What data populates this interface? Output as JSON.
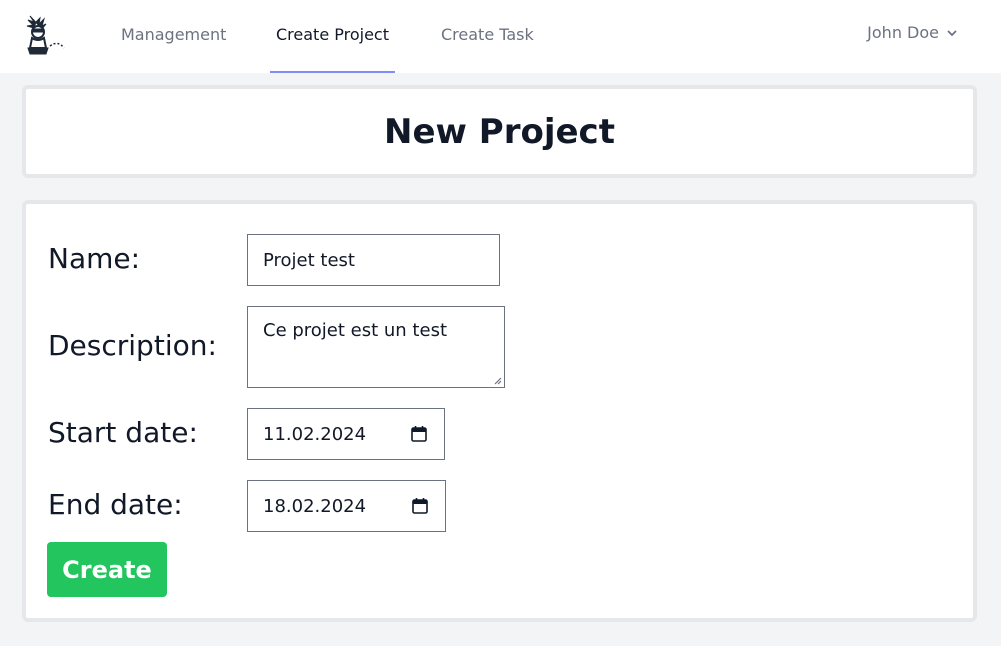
{
  "nav": {
    "links": [
      "Management",
      "Create Project",
      "Create Task"
    ],
    "active": "Create Project",
    "user_name": "John Doe"
  },
  "page": {
    "title": "New Project"
  },
  "form": {
    "name_label": "Name:",
    "name_value": "Projet test",
    "description_label": "Description:",
    "description_value": "Ce projet est un test",
    "start_label": "Start date:",
    "start_value": "11.02.2024",
    "end_label": "End date:",
    "end_value": "18.02.2024",
    "submit_label": "Create"
  },
  "colors": {
    "accent_underline": "#818cf8",
    "create_button": "#22c55e",
    "background": "#f3f4f6"
  },
  "icons": [
    "logo-icon",
    "chevron-down-icon",
    "calendar-icon",
    "resize-grip-icon"
  ]
}
